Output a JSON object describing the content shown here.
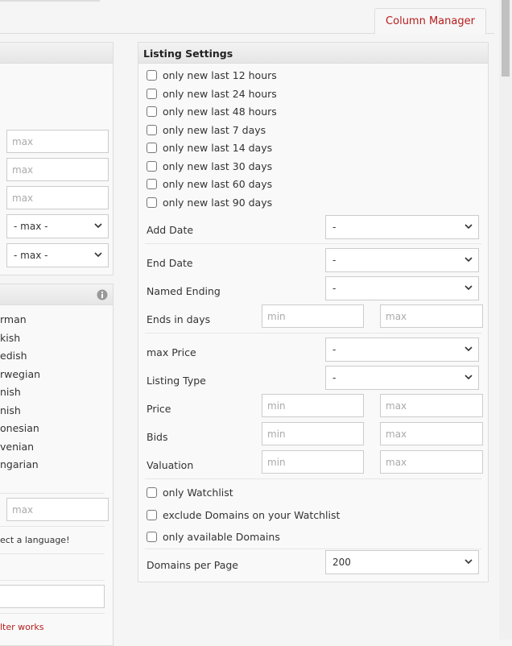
{
  "column_manager_tab": "Column Manager",
  "left_panel": {
    "max_placeholder": "max",
    "selects": [
      "- max -",
      "- max -"
    ],
    "languages": [
      "rman",
      "kish",
      "edish",
      "rwegian",
      "nish",
      "nish",
      "onesian",
      "venian",
      "ngarian"
    ],
    "warning": "ect a language!",
    "filter_link": "lter works"
  },
  "listing": {
    "title": "Listing Settings",
    "new_filters": [
      "only new last 12 hours",
      "only new last 24 hours",
      "only new last 48 hours",
      "only new last 7 days",
      "only new last 14 days",
      "only new last 30 days",
      "only new last 60 days",
      "only new last 90 days"
    ],
    "add_date": {
      "label": "Add Date",
      "value": "-"
    },
    "end_date": {
      "label": "End Date",
      "value": "-"
    },
    "named_ending": {
      "label": "Named Ending",
      "value": "-"
    },
    "ends_in_days": {
      "label": "Ends in days",
      "min": "min",
      "max": "max"
    },
    "max_price": {
      "label": "max Price",
      "value": "-"
    },
    "listing_type": {
      "label": "Listing Type",
      "value": "-"
    },
    "price": {
      "label": "Price",
      "min": "min",
      "max": "max"
    },
    "bids": {
      "label": "Bids",
      "min": "min",
      "max": "max"
    },
    "valuation": {
      "label": "Valuation",
      "min": "min",
      "max": "max"
    },
    "only_watchlist": "only Watchlist",
    "exclude_watchlist": "exclude Domains on your Watchlist",
    "only_available": "only available Domains",
    "per_page": {
      "label": "Domains per Page",
      "value": "200"
    }
  },
  "colors": {
    "accent": "#b71c1c"
  }
}
